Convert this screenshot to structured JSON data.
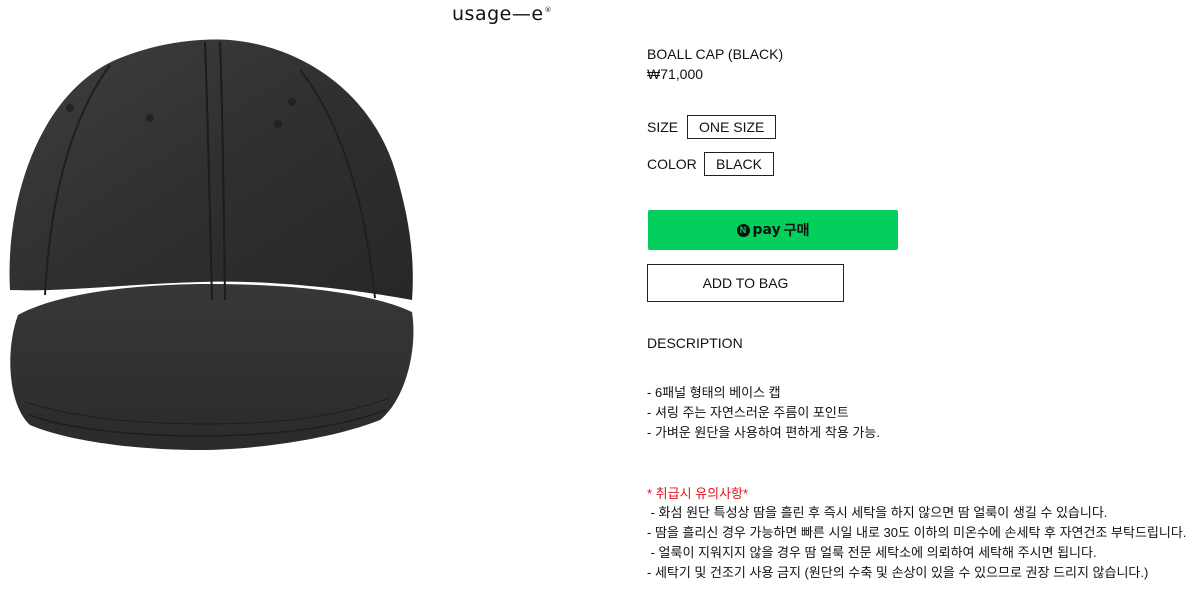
{
  "brand": {
    "logo_text": "usage",
    "logo_suffix": "e",
    "logo_mark": "®"
  },
  "product": {
    "name": "BOALL CAP (BLACK)",
    "price": "₩71,000",
    "image_icon": "black-cap-photo"
  },
  "options": {
    "size_label": "SIZE",
    "size_value": "ONE SIZE",
    "color_label": "COLOR",
    "color_value": "BLACK"
  },
  "buttons": {
    "npay_n": "N",
    "npay_pay": "pay",
    "npay_buy": "구매",
    "npay_color": "#03cf5d",
    "add_to_bag": "ADD TO BAG"
  },
  "description": {
    "title": "DESCRIPTION",
    "items": [
      "- 6패널 형태의 베이스 캡",
      "- 셔링 주는 자연스러운 주름이 포인트",
      "- 가벼운 원단을 사용하여 편하게 착용 가능."
    ]
  },
  "care": {
    "title": "* 취급시 유의사항*",
    "title_color": "#e0161f",
    "items": [
      " - 화섬 원단 특성상 땀을 흘린 후 즉시 세탁을 하지 않으면 땀 얼룩이 생길 수 있습니다.",
      "- 땀을 흘리신 경우 가능하면 빠른 시일 내로 30도 이하의 미온수에 손세탁 후 자연건조 부탁드립니다.",
      " - 얼룩이 지워지지 않을 경우 땀 얼룩 전문 세탁소에 의뢰하여 세탁해 주시면 됩니다.",
      "- 세탁기 및 건조기 사용 금지 (원단의 수축 및 손상이 있을 수 있으므로 권장 드리지 않습니다.)"
    ]
  }
}
